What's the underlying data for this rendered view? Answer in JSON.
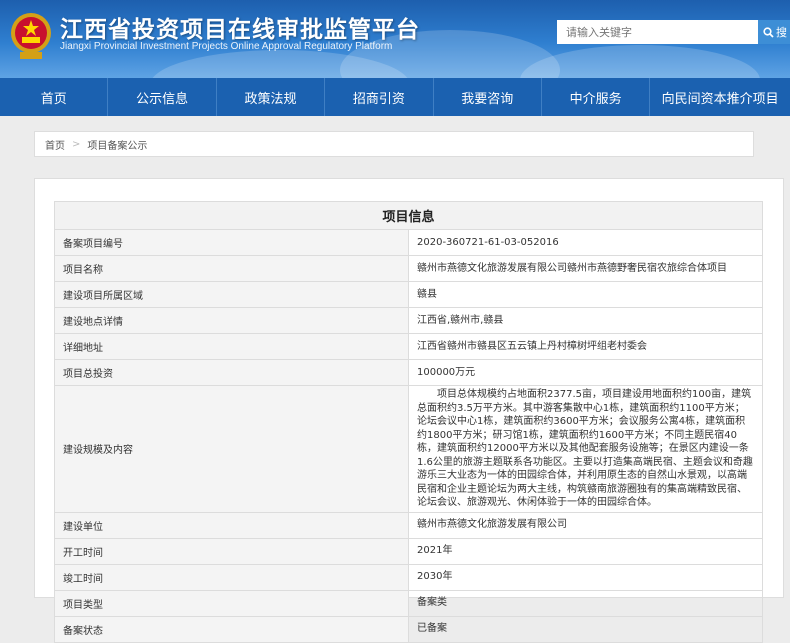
{
  "header": {
    "title_cn": "江西省投资项目在线审批监管平台",
    "title_en": "Jiangxi Provincial Investment Projects Online Approval Regulatory Platform",
    "emblem_icon": "national-emblem-icon",
    "search": {
      "placeholder": "请输入关键字",
      "button_label": "搜",
      "icon": "search-icon"
    },
    "colors": {
      "header_top": "#1d5fae",
      "header_bottom": "#5ea3e4",
      "nav": "#1b61b0",
      "search_button": "#3d8ed6"
    }
  },
  "nav": {
    "items": [
      {
        "label": "首页"
      },
      {
        "label": "公示信息"
      },
      {
        "label": "政策法规"
      },
      {
        "label": "招商引资"
      },
      {
        "label": "我要咨询"
      },
      {
        "label": "中介服务"
      },
      {
        "label": "向民间资本推介项目"
      }
    ]
  },
  "breadcrumb": {
    "home": "首页",
    "separator": ">",
    "current": "项目备案公示"
  },
  "panel": {
    "title": "项目信息",
    "rows": [
      {
        "label": "备案项目编号",
        "value": "2020-360721-61-03-052016"
      },
      {
        "label": "项目名称",
        "value": "赣州市燕德文化旅游发展有限公司赣州市燕德野奢民宿农旅综合体项目"
      },
      {
        "label": "建设项目所属区域",
        "value": "赣县"
      },
      {
        "label": "建设地点详情",
        "value": "江西省,赣州市,赣县"
      },
      {
        "label": "详细地址",
        "value": "江西省赣州市赣县区五云镇上丹村樟树坪组老村委会"
      },
      {
        "label": "项目总投资",
        "value": "100000万元"
      },
      {
        "label": "建设规模及内容",
        "value": "项目总体规模约占地面积2377.5亩，项目建设用地面积约100亩，建筑总面积约3.5万平方米。其中游客集散中心1栋，建筑面积约1100平方米；论坛会议中心1栋，建筑面积约3600平方米；会议服务公寓4栋，建筑面积约1800平方米；研习馆1栋，建筑面积约1600平方米；不同主题民宿40栋，建筑面积约12000平方米以及其他配套服务设施等；在景区内建设一条1.6公里的旅游主题联系各功能区。主要以打造集高端民宿、主题会议和奇趣游乐三大业态为一体的田园综合体，并利用原生态的自然山水景观，以高端民宿和企业主题论坛为两大主线，构筑赣南旅游圈独有的集高端精致民宿、论坛会议、旅游观光、休闲体验于一体的田园综合体。"
      },
      {
        "label": "建设单位",
        "value": "赣州市燕德文化旅游发展有限公司"
      },
      {
        "label": "开工时间",
        "value": "2021年"
      },
      {
        "label": "竣工时间",
        "value": "2030年"
      },
      {
        "label": "项目类型",
        "value": "备案类"
      },
      {
        "label": "备案状态",
        "value": "已备案"
      }
    ]
  }
}
